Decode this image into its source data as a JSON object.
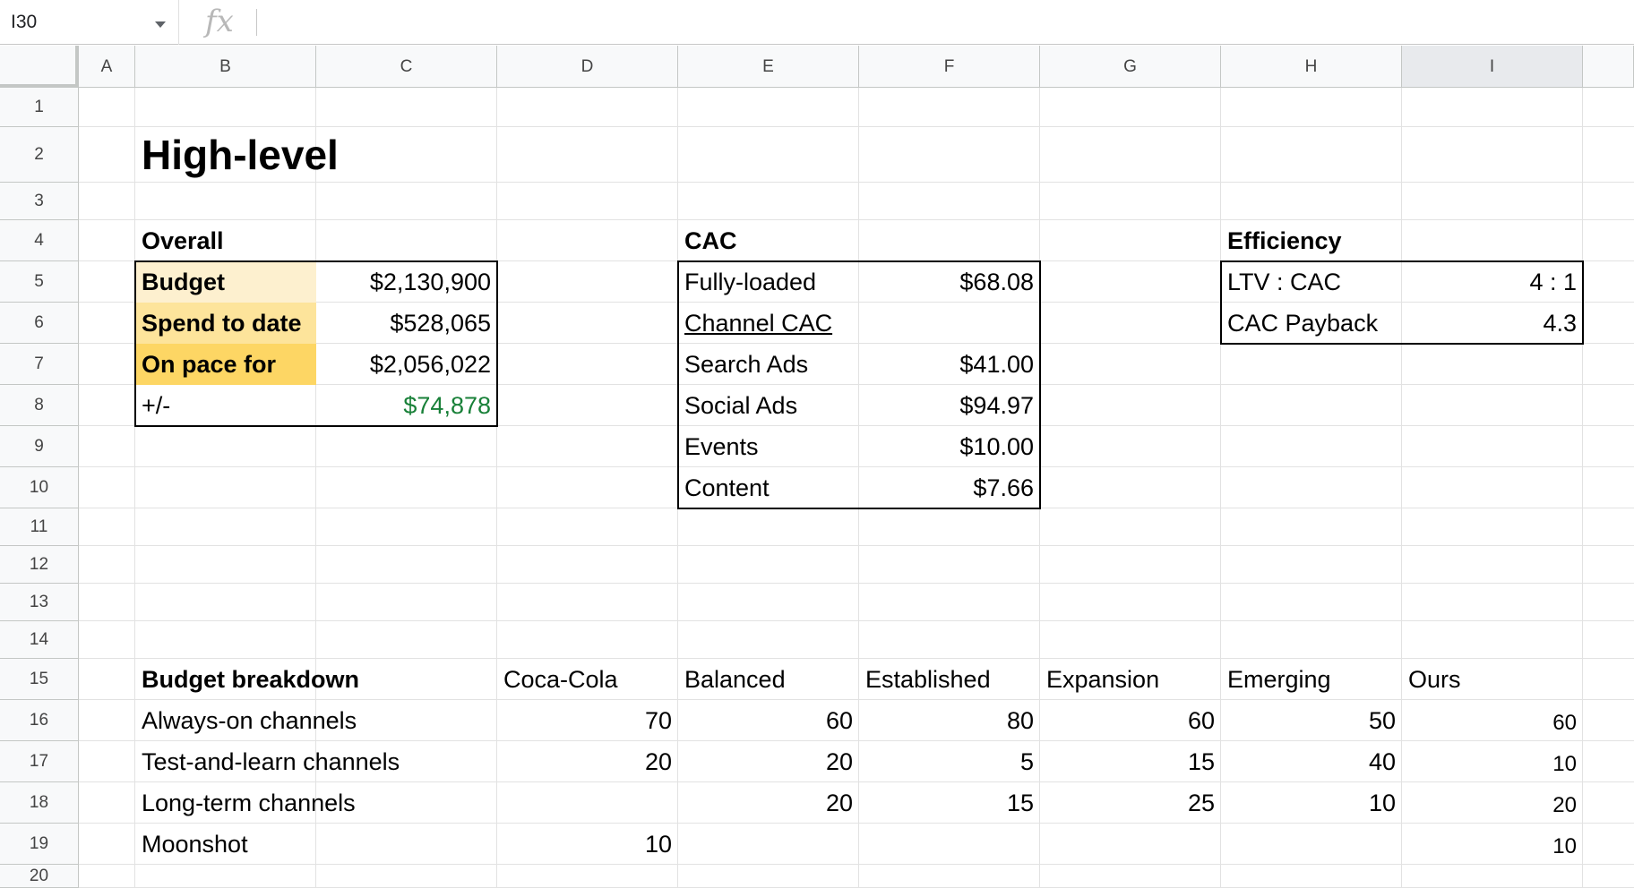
{
  "formula_bar": {
    "name_box": "I30",
    "fx_icon": "fx-icon",
    "formula_value": ""
  },
  "columns": [
    "A",
    "B",
    "C",
    "D",
    "E",
    "F",
    "G",
    "H",
    "I"
  ],
  "selected_column": "I",
  "rows": [
    "1",
    "2",
    "3",
    "4",
    "5",
    "6",
    "7",
    "8",
    "9",
    "10",
    "11",
    "12",
    "13",
    "14",
    "15",
    "16",
    "17",
    "18",
    "19",
    "20"
  ],
  "high_level": {
    "title": "High-level"
  },
  "overall": {
    "header": "Overall",
    "budget_label": "Budget",
    "budget_value": "$2,130,900",
    "spend_label": "Spend to date",
    "spend_value": "$528,065",
    "pace_label": "On pace for",
    "pace_value": "$2,056,022",
    "diff_label": "+/-",
    "diff_value": "$74,878"
  },
  "cac": {
    "header": "CAC",
    "fully_loaded_label": "Fully-loaded",
    "fully_loaded_value": "$68.08",
    "channel_cac_label": "Channel CAC",
    "search_label": "Search Ads",
    "search_value": "$41.00",
    "social_label": "Social Ads",
    "social_value": "$94.97",
    "events_label": "Events",
    "events_value": "$10.00",
    "content_label": "Content",
    "content_value": "$7.66"
  },
  "efficiency": {
    "header": "Efficiency",
    "ltv_label": "LTV : CAC",
    "ltv_value": "4 : 1",
    "payback_label": "CAC Payback",
    "payback_value": "4.3"
  },
  "budget_breakdown": {
    "header": "Budget breakdown",
    "columns": [
      "Coca-Cola",
      "Balanced",
      "Established",
      "Expansion",
      "Emerging",
      "Ours"
    ],
    "rows": [
      {
        "label": "Always-on channels",
        "values": [
          "70",
          "60",
          "80",
          "60",
          "50",
          "60"
        ]
      },
      {
        "label": "Test-and-learn channels",
        "values": [
          "20",
          "20",
          "5",
          "15",
          "40",
          "10"
        ]
      },
      {
        "label": "Long-term channels",
        "values": [
          "",
          "20",
          "15",
          "25",
          "10",
          "20"
        ]
      },
      {
        "label": "Moonshot",
        "values": [
          "10",
          "",
          "",
          "",
          "",
          "10"
        ]
      }
    ]
  },
  "colors": {
    "budget_fill": "#fdf0cf",
    "spend_fill": "#fde49b",
    "pace_fill": "#fdd664",
    "positive_green": "#188038"
  }
}
